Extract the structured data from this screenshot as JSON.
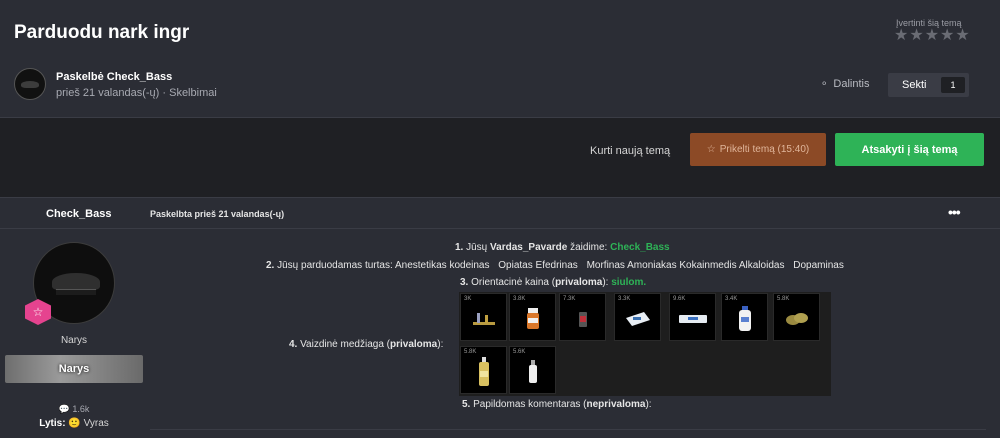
{
  "topic": {
    "title": "Parduodu nark ingr",
    "rate_label": "Įvertinti šią temą",
    "stars": [
      "★",
      "★",
      "★",
      "★",
      "★"
    ],
    "author_line": "Paskelbė Check_Bass",
    "meta_line": "prieš 21 valandas(-ų) · Skelbimai",
    "share_label": "Dalintis",
    "follow_label": "Sekti",
    "follow_count": "1"
  },
  "actions": {
    "new_topic": "Kurti naują temą",
    "promote": "Prikelti temą (15:40)",
    "reply": "Atsakyti į šią temą"
  },
  "post": {
    "author": "Check_Bass",
    "posted": "Paskelbta prieš 21 valandas(-ų)",
    "more": "•••",
    "group_name": "Narys",
    "group_banner": "Narys",
    "post_count": "1.6k",
    "gender_label": "Lytis:",
    "gender_value": "Vyras",
    "body": {
      "l1_num": "1.",
      "l1_a": "Jūsų",
      "l1_b": "Vardas_Pavarde",
      "l1_c": "žaidime:",
      "l1_d": "Check_Bass",
      "l2_num": "2.",
      "l2_a": "Jūsų parduodamas turtas:",
      "l2_items": [
        "Anestetikas kodeinas",
        "Opiatas Efedrinas",
        "Morfinas Amoniakas Kokainmedis Alkaloidas",
        "Dopaminas"
      ],
      "l3_num": "3.",
      "l3_a": "Orientacinė kaina (",
      "l3_b": "privaloma",
      "l3_c": "):",
      "l3_d": "siulom.",
      "l4_num": "4.",
      "l4_a": "Vaizdinė medžiaga (",
      "l4_b": "privaloma",
      "l4_c": "):",
      "l5_num": "5.",
      "l5_a": "Papildomas komentaras (",
      "l5_b": "neprivaloma",
      "l5_c": "):"
    },
    "tiles": [
      {
        "price": "3K",
        "icon": "rack-icon"
      },
      {
        "price": "3.8K",
        "icon": "pill-bottle-icon"
      },
      {
        "price": "7.3K",
        "icon": "red-can-icon"
      },
      {
        "price": "3.3K",
        "icon": "pill-box-icon"
      },
      {
        "price": "9.6K",
        "icon": "tablet-strip-icon"
      },
      {
        "price": "3.4K",
        "icon": "bleach-bottle-icon"
      },
      {
        "price": "5.8K",
        "icon": "leaves-icon"
      },
      {
        "price": "5.8K",
        "icon": "yellow-bottle-icon"
      },
      {
        "price": "5.6K",
        "icon": "vial-icon"
      }
    ]
  }
}
